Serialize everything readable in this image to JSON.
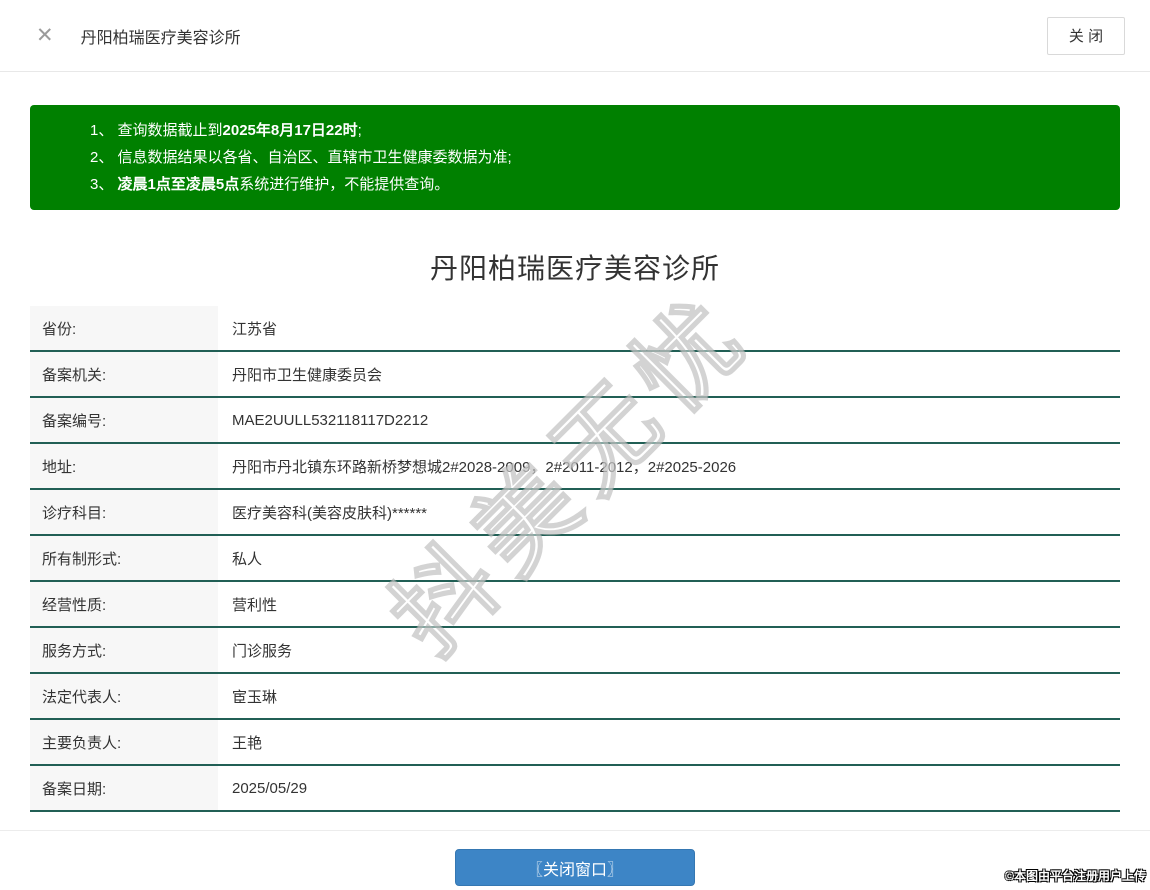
{
  "header": {
    "close_icon": "✕",
    "title": "丹阳柏瑞医疗美容诊所",
    "close_button_label": "关 闭"
  },
  "notice": {
    "background_color": "#008000",
    "items": [
      {
        "pre": "1、 查询数据截止到",
        "bold": "2025年8月17日22时",
        "post": ";"
      },
      {
        "pre": "2、 信息数据结果以各省、自治区、直辖市卫生健康委数据为准;",
        "bold": "",
        "post": ""
      },
      {
        "pre": "3、 ",
        "bold": "凌晨1点至凌晨5点",
        "post": "系统进行维护，不能提供查询。"
      }
    ]
  },
  "main": {
    "title": "丹阳柏瑞医疗美容诊所",
    "table": {
      "separator_color": "#215f55",
      "rows": [
        {
          "label": "省份:",
          "value": "江苏省"
        },
        {
          "label": "备案机关:",
          "value": "丹阳市卫生健康委员会"
        },
        {
          "label": "备案编号:",
          "value": "MAE2UULL532118117D2212"
        },
        {
          "label": "地址:",
          "value": "丹阳市丹北镇东环路新桥梦想城2#2028-2009，2#2011-2012，2#2025-2026"
        },
        {
          "label": "诊疗科目:",
          "value": "医疗美容科(美容皮肤科)******"
        },
        {
          "label": "所有制形式:",
          "value": "私人"
        },
        {
          "label": "经营性质:",
          "value": "营利性"
        },
        {
          "label": "服务方式:",
          "value": "门诊服务"
        },
        {
          "label": "法定代表人:",
          "value": "宦玉琳"
        },
        {
          "label": "主要负责人:",
          "value": "王艳"
        },
        {
          "label": "备案日期:",
          "value": "2025/05/29"
        }
      ]
    },
    "close_window_button_label": "〖关闭窗口〗",
    "button_color": "#3d85c6"
  },
  "watermark": "抖美无忧",
  "copyright": "©本图由平台注册用户上传"
}
